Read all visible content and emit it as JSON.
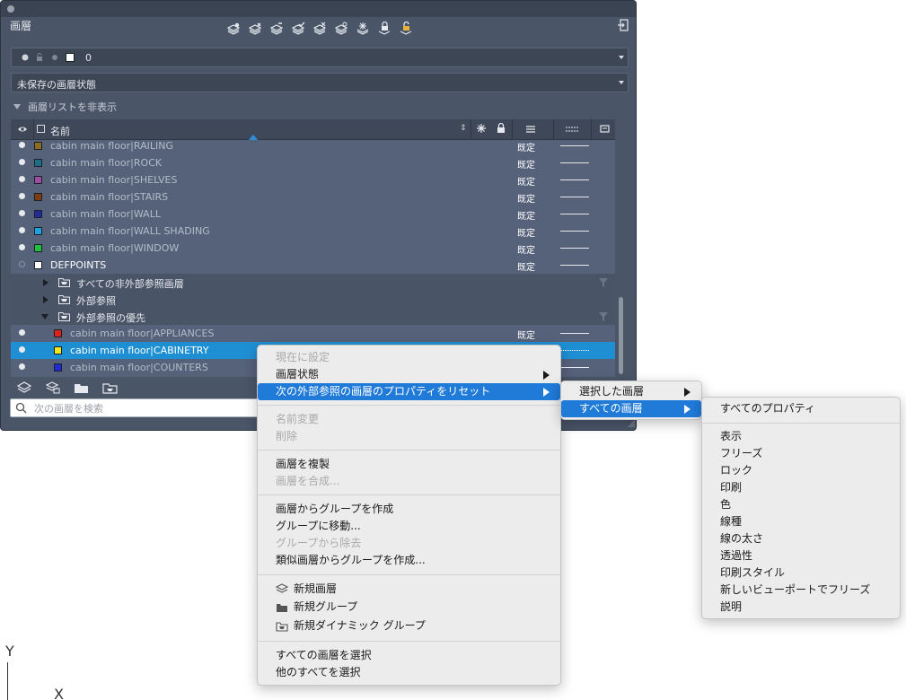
{
  "palette": {
    "title": "画層",
    "toolbar_icons": [
      "new-layer-icon",
      "new-layer-vp-frozen-icon",
      "delete-layer-icon",
      "set-current-icon",
      "isolate-icon",
      "unisolate-icon",
      "freeze-icon",
      "lock-icon",
      "unlock-icon"
    ],
    "current_layer": "0",
    "layer_state": "未保存の画層状態",
    "hide_list_label": "画層リストを非表示",
    "columns": {
      "name": "名前"
    },
    "rows_top": [
      {
        "name": "cabin main floor|RAILING",
        "color": "#8a6d1e",
        "linetype": "既定"
      },
      {
        "name": "cabin main floor|ROCK",
        "color": "#1c6f86",
        "linetype": "既定"
      },
      {
        "name": "cabin main floor|SHELVES",
        "color": "#9a4fa2",
        "linetype": "既定"
      },
      {
        "name": "cabin main floor|STAIRS",
        "color": "#7a3e12",
        "linetype": "既定"
      },
      {
        "name": "cabin main floor|WALL",
        "color": "#232a9a",
        "linetype": "既定"
      },
      {
        "name": "cabin main floor|WALL SHADING",
        "color": "#1da3e0",
        "linetype": "既定"
      },
      {
        "name": "cabin main floor|WINDOW",
        "color": "#1ec23c",
        "linetype": "既定"
      },
      {
        "name": "DEFPOINTS",
        "color": "#ffffff",
        "linetype": "既定"
      }
    ],
    "groups": [
      {
        "label": "すべての非外部参照画層"
      },
      {
        "label": "外部参照"
      },
      {
        "label": "外部参照の優先"
      }
    ],
    "rows_bottom": [
      {
        "name": "cabin main floor|APPLIANCES",
        "color": "#e0201a",
        "linetype": "既定"
      },
      {
        "name": "cabin main floor|CABINETRY",
        "color": "#f4ea1a",
        "linetype": ""
      },
      {
        "name": "cabin main floor|COUNTERS",
        "color": "#1f2bd6",
        "linetype": ""
      }
    ],
    "search_placeholder": "次の画層を検索"
  },
  "context_menu": {
    "items": [
      {
        "label": "現在に設定"
      },
      {
        "label": "画層状態"
      },
      {
        "label": "次の外部参照の画層のプロパティをリセット"
      },
      {
        "label": "名前変更"
      },
      {
        "label": "削除"
      },
      {
        "label": "画層を複製"
      },
      {
        "label": "画層を合成..."
      },
      {
        "label": "画層からグループを作成"
      },
      {
        "label": "グループに移動..."
      },
      {
        "label": "グループから除去"
      },
      {
        "label": "類似画層からグループを作成..."
      },
      {
        "label": "新規画層"
      },
      {
        "label": "新規グループ"
      },
      {
        "label": "新規ダイナミック グループ"
      },
      {
        "label": "すべての画層を選択"
      },
      {
        "label": "他のすべてを選択"
      }
    ]
  },
  "submenu_reset": {
    "items": [
      {
        "label": "選択した画層"
      },
      {
        "label": "すべての画層"
      }
    ]
  },
  "submenu_props": {
    "items": [
      {
        "label": "すべてのプロパティ"
      },
      {
        "label": "表示"
      },
      {
        "label": "フリーズ"
      },
      {
        "label": "ロック"
      },
      {
        "label": "印刷"
      },
      {
        "label": "色"
      },
      {
        "label": "線種"
      },
      {
        "label": "線の太さ"
      },
      {
        "label": "透過性"
      },
      {
        "label": "印刷スタイル"
      },
      {
        "label": "新しいビューポートでフリーズ"
      },
      {
        "label": "説明"
      }
    ]
  },
  "ucs": {
    "y_label": "Y",
    "x_label": "X"
  },
  "colors": {
    "selection": "#1f8fd3",
    "menu_highlight": "#1f7ad8",
    "panel": "#4a5568"
  }
}
